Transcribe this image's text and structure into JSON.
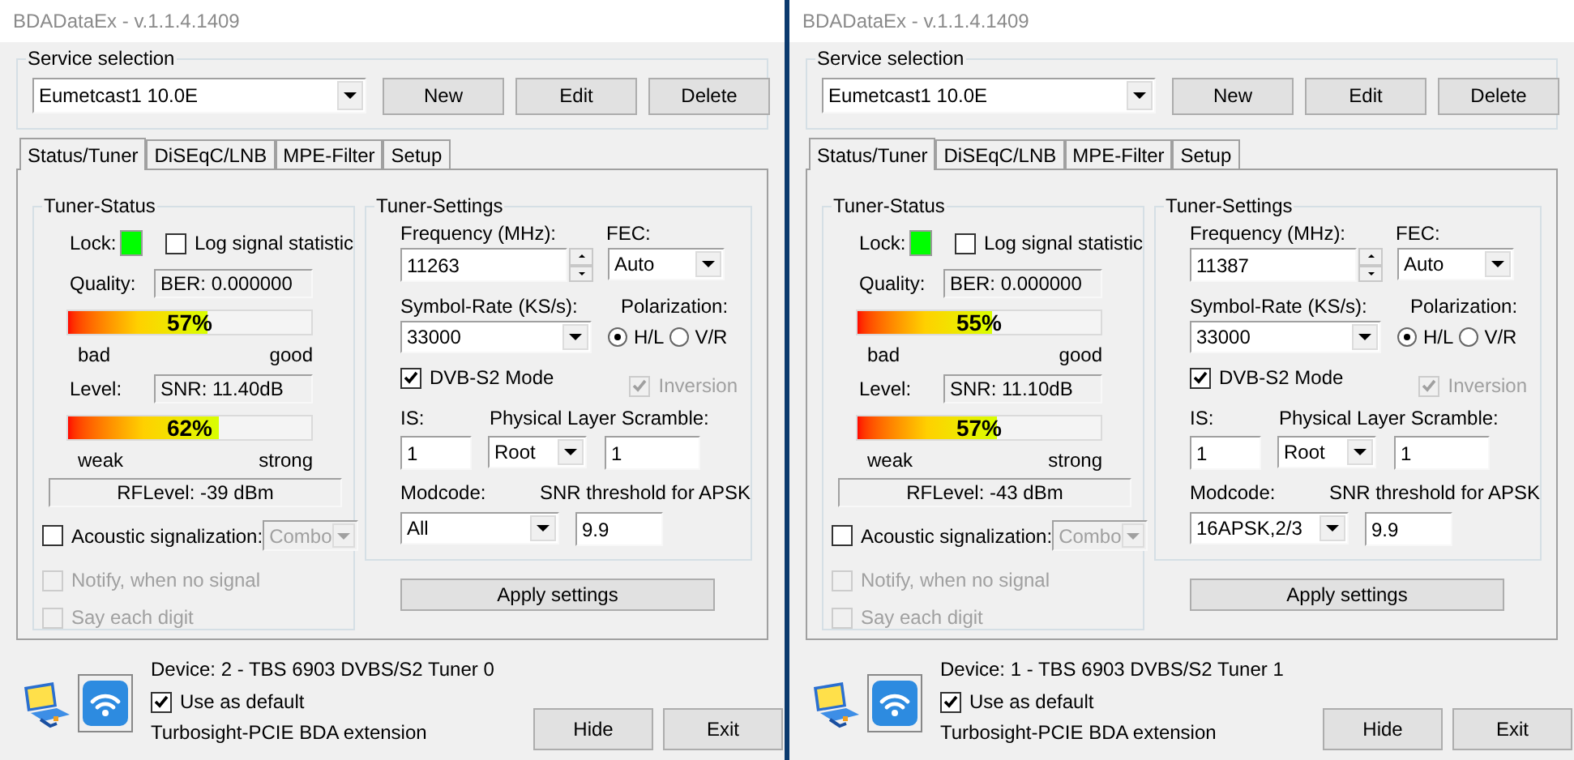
{
  "windows": [
    {
      "title": "BDADataEx - v.1.1.4.1409",
      "service_selection": {
        "label": "Service selection",
        "value": "Eumetcast1 10.0E",
        "buttons": [
          "New",
          "Edit",
          "Delete"
        ]
      },
      "tabs": [
        {
          "label": "Status/Tuner",
          "selected": true
        },
        {
          "label": "DiSEqC/LNB",
          "selected": false
        },
        {
          "label": "MPE-Filter",
          "selected": false
        },
        {
          "label": "Setup",
          "selected": false
        }
      ],
      "tuner_status": {
        "title": "Tuner-Status",
        "lock_label": "Lock:",
        "locked": true,
        "log_signal": {
          "label": "Log signal statistic",
          "checked": false
        },
        "quality_label": "Quality:",
        "ber": "BER: 0.000000",
        "quality": {
          "level": 0.57,
          "reading": "57%"
        },
        "quality_low": "bad",
        "quality_high": "good",
        "level_label": "Level:",
        "snr": "SNR: 11.40dB",
        "signal": {
          "level": 0.62,
          "reading": "62%"
        },
        "signal_low": "weak",
        "signal_high": "strong",
        "rf_level": "RFLevel: -39 dBm",
        "acoustic": {
          "label": "Acoustic signalization:",
          "checked": false,
          "mode": "Combo",
          "disabled": true
        },
        "notify": {
          "label": "Notify, when no signal",
          "checked": false,
          "disabled": true
        },
        "say_digit": {
          "label": "Say each digit",
          "checked": false,
          "disabled": true
        }
      },
      "tuner_settings": {
        "title": "Tuner-Settings",
        "frequency_label": "Frequency (MHz):",
        "frequency": "11263",
        "fec_label": "FEC:",
        "fec": "Auto",
        "symbol_rate_label": "Symbol-Rate (KS/s):",
        "symbol_rate": "33000",
        "polarization_label": "Polarization:",
        "polarization": [
          {
            "label": "H/L",
            "selected": true
          },
          {
            "label": "V/R",
            "selected": false
          }
        ],
        "dvb_s2": {
          "label": "DVB-S2 Mode",
          "checked": true,
          "disabled": false
        },
        "inversion": {
          "label": "Inversion",
          "checked": true,
          "disabled": true
        },
        "is_label": "IS:",
        "is": "1",
        "pls_label": "Physical Layer Scramble:",
        "pls_mode": "Root",
        "pls": "1",
        "modcode_label": "Modcode:",
        "modcode": "All",
        "snr_threshold_label": "SNR threshold for APSK",
        "snr_threshold": "9.9"
      },
      "apply_button": "Apply settings",
      "device": "Device: 2 - TBS 6903 DVBS/S2 Tuner 0",
      "use_default": {
        "label": "Use as default",
        "checked": true
      },
      "extension": "Turbosight-PCIE BDA extension",
      "buttons": [
        "Hide",
        "Exit"
      ]
    },
    {
      "title": "BDADataEx - v.1.1.4.1409",
      "service_selection": {
        "label": "Service selection",
        "value": "Eumetcast1 10.0E",
        "buttons": [
          "New",
          "Edit",
          "Delete"
        ]
      },
      "tabs": [
        {
          "label": "Status/Tuner",
          "selected": true
        },
        {
          "label": "DiSEqC/LNB",
          "selected": false
        },
        {
          "label": "MPE-Filter",
          "selected": false
        },
        {
          "label": "Setup",
          "selected": false
        }
      ],
      "tuner_status": {
        "title": "Tuner-Status",
        "lock_label": "Lock:",
        "locked": true,
        "log_signal": {
          "label": "Log signal statistic",
          "checked": false
        },
        "quality_label": "Quality:",
        "ber": "BER: 0.000000",
        "quality": {
          "level": 0.55,
          "reading": "55%"
        },
        "quality_low": "bad",
        "quality_high": "good",
        "level_label": "Level:",
        "snr": "SNR: 11.10dB",
        "signal": {
          "level": 0.57,
          "reading": "57%"
        },
        "signal_low": "weak",
        "signal_high": "strong",
        "rf_level": "RFLevel: -43 dBm",
        "acoustic": {
          "label": "Acoustic signalization:",
          "checked": false,
          "mode": "Combo",
          "disabled": true
        },
        "notify": {
          "label": "Notify, when no signal",
          "checked": false,
          "disabled": true
        },
        "say_digit": {
          "label": "Say each digit",
          "checked": false,
          "disabled": true
        }
      },
      "tuner_settings": {
        "title": "Tuner-Settings",
        "frequency_label": "Frequency (MHz):",
        "frequency": "11387",
        "fec_label": "FEC:",
        "fec": "Auto",
        "symbol_rate_label": "Symbol-Rate (KS/s):",
        "symbol_rate": "33000",
        "polarization_label": "Polarization:",
        "polarization": [
          {
            "label": "H/L",
            "selected": true
          },
          {
            "label": "V/R",
            "selected": false
          }
        ],
        "dvb_s2": {
          "label": "DVB-S2 Mode",
          "checked": true,
          "disabled": false
        },
        "inversion": {
          "label": "Inversion",
          "checked": true,
          "disabled": true
        },
        "is_label": "IS:",
        "is": "1",
        "pls_label": "Physical Layer Scramble:",
        "pls_mode": "Root",
        "pls": "1",
        "modcode_label": "Modcode:",
        "modcode": "16APSK,2/3",
        "snr_threshold_label": "SNR threshold for APSK",
        "snr_threshold": "9.9"
      },
      "apply_button": "Apply settings",
      "device": "Device: 1 - TBS 6903 DVBS/S2 Tuner 1",
      "use_default": {
        "label": "Use as default",
        "checked": true
      },
      "extension": "Turbosight-PCIE BDA extension",
      "buttons": [
        "Hide",
        "Exit"
      ]
    }
  ]
}
